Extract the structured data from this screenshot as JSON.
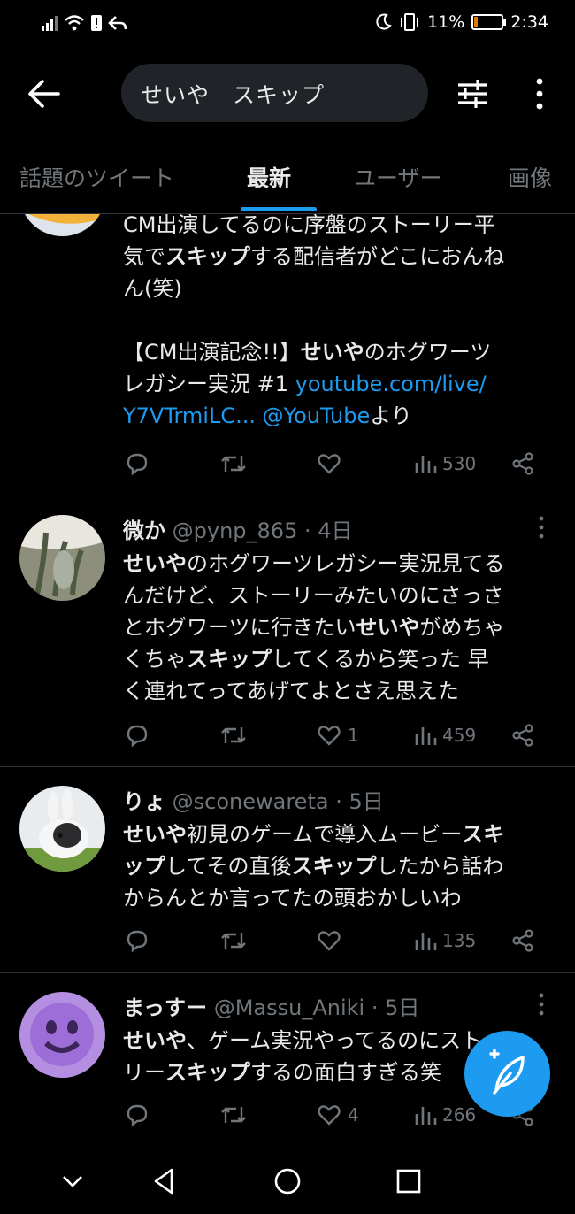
{
  "status_bar": {
    "battery_percent": "11%",
    "battery_level": 0.11,
    "time": "2:34"
  },
  "header": {
    "search_query": "せいや　スキップ",
    "icons": [
      "back-arrow-icon",
      "filter-sliders-icon",
      "more-vertical-icon"
    ]
  },
  "tabs": [
    {
      "label": "話題のツイート",
      "active": false
    },
    {
      "label": "最新",
      "active": true
    },
    {
      "label": "ユーザー",
      "active": false
    },
    {
      "label": "画像",
      "active": false
    }
  ],
  "tweets": [
    {
      "lines": [
        [
          "CM出演してるのに序盤のストーリー平"
        ],
        [
          "気で",
          {
            "b": "スキップ"
          },
          "する配信者がどこにおんね"
        ],
        [
          "ん(笑)"
        ],
        [
          ""
        ],
        [
          "【CM出演記念!!】",
          {
            "b": "せいや"
          },
          "のホグワーツ"
        ],
        [
          "レガシー実況 #1 ",
          {
            "link": "youtube.com/live/"
          }
        ],
        [
          {
            "link": "Y7VTrmiLC... @YouTube"
          },
          "より"
        ]
      ],
      "actions": {
        "reply": "",
        "retweet": "",
        "like": "",
        "views": "530"
      }
    },
    {
      "name": "微か",
      "handle": "@pynp_865",
      "time": "4日",
      "lines": [
        [
          {
            "b": "せいや"
          },
          "のホグワーツレガシー実況見てる"
        ],
        [
          "んだけど、ストーリーみたいのにさっさ"
        ],
        [
          "とホグワーツに行きたい",
          {
            "b": "せいや"
          },
          "がめちゃ"
        ],
        [
          "くちゃ",
          {
            "b": "スキップ"
          },
          "してくるから笑った 早"
        ],
        [
          "く連れてってあげてよとさえ思えた"
        ]
      ],
      "actions": {
        "reply": "",
        "retweet": "",
        "like": "1",
        "views": "459"
      }
    },
    {
      "name": "りょ",
      "handle": "@sconewareta",
      "time": "5日",
      "lines": [
        [
          {
            "b": "せいや"
          },
          "初見のゲームで導入ムービー",
          {
            "b": "スキ"
          }
        ],
        [
          {
            "b": "ップ"
          },
          "してその直後",
          {
            "b": "スキップ"
          },
          "したから話わ"
        ],
        [
          "からんとか言ってたの頭おかしいわ"
        ]
      ],
      "actions": {
        "reply": "",
        "retweet": "",
        "like": "",
        "views": "135"
      }
    },
    {
      "name": "まっすー",
      "handle": "@Massu_Aniki",
      "time": "5日",
      "lines": [
        [
          {
            "b": "せいや"
          },
          "、ゲーム実況やってるのにストー"
        ],
        [
          "リー",
          {
            "b": "スキップ"
          },
          "するの面白すぎる笑"
        ]
      ],
      "actions": {
        "reply": "",
        "retweet": "",
        "like": "4",
        "views": "266"
      }
    }
  ],
  "fab": {
    "icon": "compose-feather-icon"
  },
  "nav_bar": {
    "icons": [
      "collapse-chevron-icon",
      "nav-back-icon",
      "nav-home-icon",
      "nav-recents-icon"
    ]
  },
  "colors": {
    "background": "#000000",
    "accent": "#1d9bf0",
    "muted": "#71767b",
    "text": "#e7e9ea",
    "divider": "#2f3336"
  }
}
